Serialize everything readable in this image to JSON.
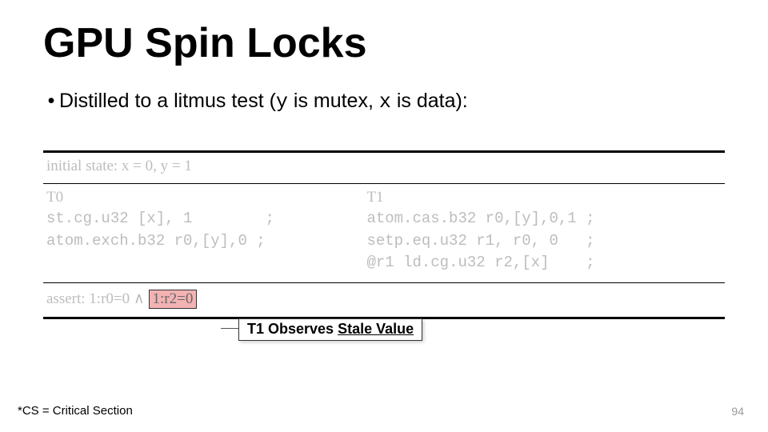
{
  "title": "GPU Spin Locks",
  "bullet": {
    "pre": "Distilled to a litmus test (",
    "y": "y",
    "mid1": " is mutex, ",
    "x": "x",
    "mid2": " is data):"
  },
  "litmus": {
    "initial": "initial state: x = 0, y = 1",
    "t0": {
      "label": "T0",
      "code": "st.cg.u32 [x], 1        ;\natom.exch.b32 r0,[y],0 ;"
    },
    "t1": {
      "label": "T1",
      "code": "atom.cas.b32 r0,[y],0,1 ;\nsetp.eq.u32 r1, r0, 0   ;\n@r1 ld.cg.u32 r2,[x]    ;"
    },
    "assert": {
      "prefix": "assert: 1:r0=0 ∧ ",
      "hl": "1:r2=0"
    }
  },
  "callout": {
    "pre": "T1 Observes ",
    "underline": "Stale Value"
  },
  "footnote": "*CS = Critical Section",
  "page": "94"
}
